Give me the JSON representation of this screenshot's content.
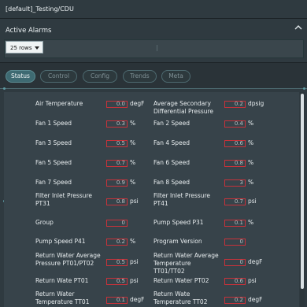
{
  "window": {
    "title": "[default]_Testing/CDU"
  },
  "alarms": {
    "title": "Active Alarms",
    "rows_select": "25 rows",
    "collapse_icon": "chevron-up-icon"
  },
  "tabs": [
    {
      "label": "Status",
      "active": true
    },
    {
      "label": "Control",
      "active": false
    },
    {
      "label": "Config",
      "active": false
    },
    {
      "label": "Trends",
      "active": false
    },
    {
      "label": "Meta",
      "active": false
    }
  ],
  "colors": {
    "accent": "#3e6a72",
    "value_border": "#c8323a",
    "panel": "#37434a"
  },
  "rows": [
    {
      "left": {
        "label": "Air Temperature",
        "value": "0.0",
        "unit": "degF"
      },
      "right": {
        "label": "Average Secondary Differential Pressure",
        "value": "0.2",
        "unit": "dpsig"
      }
    },
    {
      "left": {
        "label": "Fan 1 Speed",
        "value": "0.3",
        "unit": "%"
      },
      "right": {
        "label": "Fan 2 Speed",
        "value": "0.4",
        "unit": "%"
      }
    },
    {
      "left": {
        "label": "Fan 3 Speed",
        "value": "0.5",
        "unit": "%"
      },
      "right": {
        "label": "Fan 4 Speed",
        "value": "0.6",
        "unit": "%"
      }
    },
    {
      "left": {
        "label": "Fan 5 Speed",
        "value": "0.7",
        "unit": "%"
      },
      "right": {
        "label": "Fan 6 Speed",
        "value": "0.8",
        "unit": "%"
      }
    },
    {
      "left": {
        "label": "Fan 7 Speed",
        "value": "0.9",
        "unit": "%"
      },
      "right": {
        "label": "Fan 8 Speed",
        "value": "3",
        "unit": "%"
      }
    },
    {
      "left": {
        "label": "Filter Inlet Pressure PT31",
        "value": "0.8",
        "unit": "psi"
      },
      "right": {
        "label": "Filter Inlet Pressure PT41",
        "value": "0.7",
        "unit": "psi"
      }
    },
    {
      "left": {
        "label": "Group",
        "value": "0",
        "unit": ""
      },
      "right": {
        "label": "Pump Speed P31",
        "value": "0.1",
        "unit": "%"
      }
    },
    {
      "left": {
        "label": "Pump Speed P41",
        "value": "0.2",
        "unit": "%"
      },
      "right": {
        "label": "Program Version",
        "value": "0",
        "unit": ""
      }
    },
    {
      "left": {
        "label": "Return Water Average Pressure PT01/PT02",
        "value": "0.5",
        "unit": "psi"
      },
      "right": {
        "label": "Return Water Average Temperature TT01/TT02",
        "value": "0",
        "unit": "degF"
      }
    },
    {
      "left": {
        "label": "Return Wate PT01",
        "value": "0.5",
        "unit": "psi"
      },
      "right": {
        "label": "Return Water PT02",
        "value": "0.6",
        "unit": "psi"
      }
    },
    {
      "left": {
        "label": "Return Water Temperature TT01",
        "value": "0.1",
        "unit": "degF"
      },
      "right": {
        "label": "Return Wate Temperature TT02",
        "value": "0.2",
        "unit": "degF"
      }
    }
  ]
}
